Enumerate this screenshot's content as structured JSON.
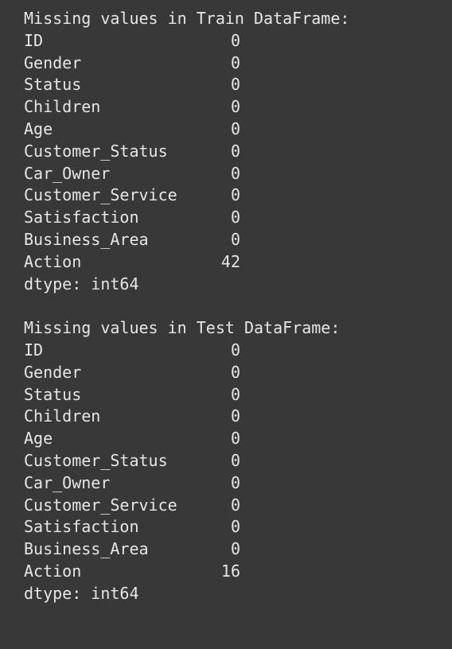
{
  "train": {
    "heading": "Missing values in Train DataFrame:",
    "rows": [
      {
        "name": "ID",
        "count": "0"
      },
      {
        "name": "Gender",
        "count": "0"
      },
      {
        "name": "Status",
        "count": "0"
      },
      {
        "name": "Children",
        "count": "0"
      },
      {
        "name": "Age",
        "count": "0"
      },
      {
        "name": "Customer_Status",
        "count": "0"
      },
      {
        "name": "Car_Owner",
        "count": "0"
      },
      {
        "name": "Customer_Service",
        "count": "0"
      },
      {
        "name": "Satisfaction",
        "count": "0"
      },
      {
        "name": "Business_Area",
        "count": "0"
      },
      {
        "name": "Action",
        "count": "42"
      }
    ],
    "dtype": "dtype: int64"
  },
  "test": {
    "heading": "Missing values in Test DataFrame:",
    "rows": [
      {
        "name": "ID",
        "count": "0"
      },
      {
        "name": "Gender",
        "count": "0"
      },
      {
        "name": "Status",
        "count": "0"
      },
      {
        "name": "Children",
        "count": "0"
      },
      {
        "name": "Age",
        "count": "0"
      },
      {
        "name": "Customer_Status",
        "count": "0"
      },
      {
        "name": "Car_Owner",
        "count": "0"
      },
      {
        "name": "Customer_Service",
        "count": "0"
      },
      {
        "name": "Satisfaction",
        "count": "0"
      },
      {
        "name": "Business_Area",
        "count": "0"
      },
      {
        "name": "Action",
        "count": "16"
      }
    ],
    "dtype": "dtype: int64"
  }
}
